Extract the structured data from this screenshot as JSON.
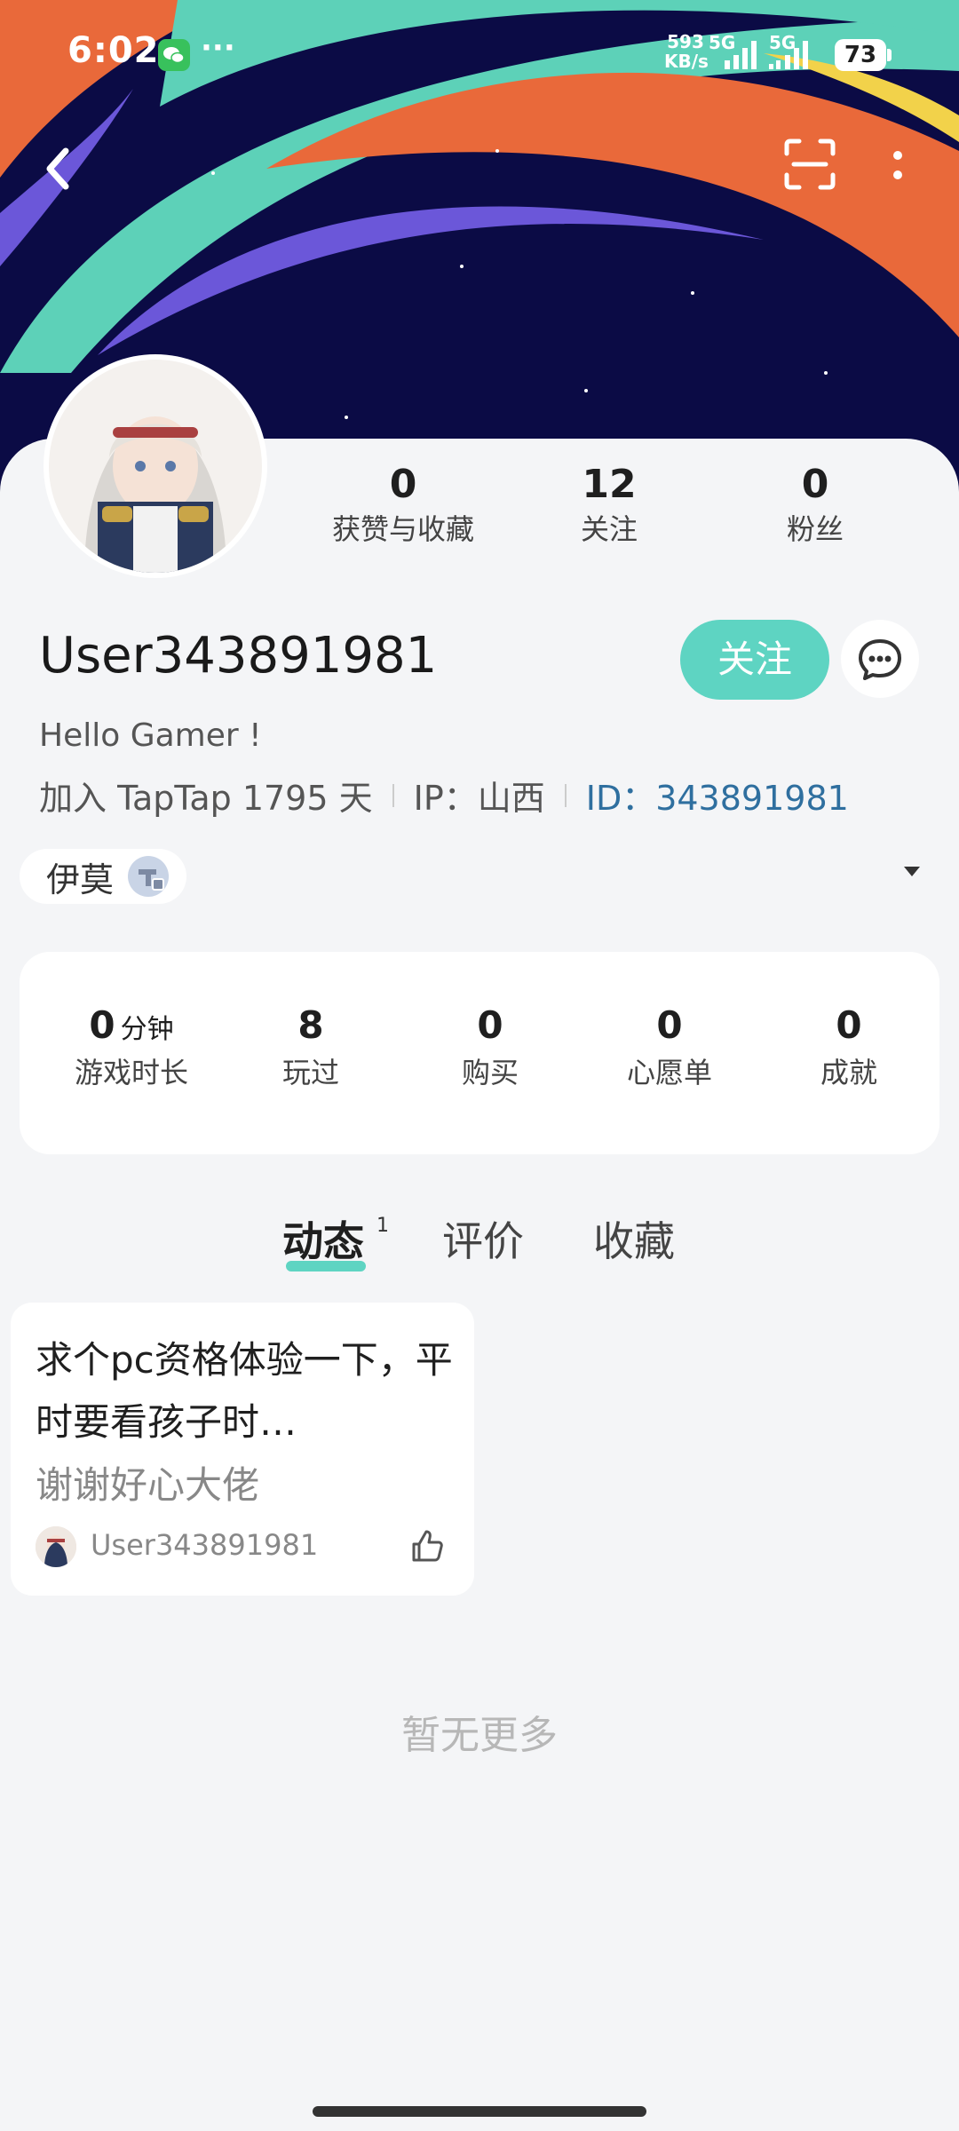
{
  "status_bar": {
    "time": "6:02",
    "net_speed_value": "593",
    "net_speed_unit": "KB/s",
    "signal_1": "5G",
    "signal_2": "5G",
    "battery": "73",
    "wechat_icon": "wechat-icon",
    "overflow": "···"
  },
  "header": {
    "back_icon": "chevron-left-icon",
    "scan_icon": "scan-icon",
    "more_icon": "more-vertical-icon"
  },
  "profile": {
    "stats": [
      {
        "value": "0",
        "label": "获赞与收藏"
      },
      {
        "value": "12",
        "label": "关注"
      },
      {
        "value": "0",
        "label": "粉丝"
      }
    ],
    "username": "User343891981",
    "follow_label": "关注",
    "bio": "Hello Gamer !",
    "joined": "加入 TapTap 1795 天",
    "ip": "IP：山西",
    "id": "ID：343891981"
  },
  "game_chip": {
    "label": "伊莫"
  },
  "stats_card": {
    "items": [
      {
        "value": "0",
        "unit": "分钟",
        "label": "游戏时长"
      },
      {
        "value": "8",
        "unit": "",
        "label": "玩过"
      },
      {
        "value": "0",
        "unit": "",
        "label": "购买"
      },
      {
        "value": "0",
        "unit": "",
        "label": "心愿单"
      },
      {
        "value": "0",
        "unit": "",
        "label": "成就"
      }
    ]
  },
  "tabs": {
    "items": [
      {
        "label": "动态",
        "badge": "1"
      },
      {
        "label": "评价",
        "badge": ""
      },
      {
        "label": "收藏",
        "badge": ""
      }
    ]
  },
  "post": {
    "title": "求个pc资格体验一下，平时要看孩子时…",
    "subtitle": "谢谢好心大佬",
    "author": "User343891981"
  },
  "footer": {
    "no_more": "暂无更多"
  },
  "colors": {
    "accent": "#5ed4c2",
    "id_link": "#2f6f9f",
    "banner_bg": "#0b0b45"
  }
}
